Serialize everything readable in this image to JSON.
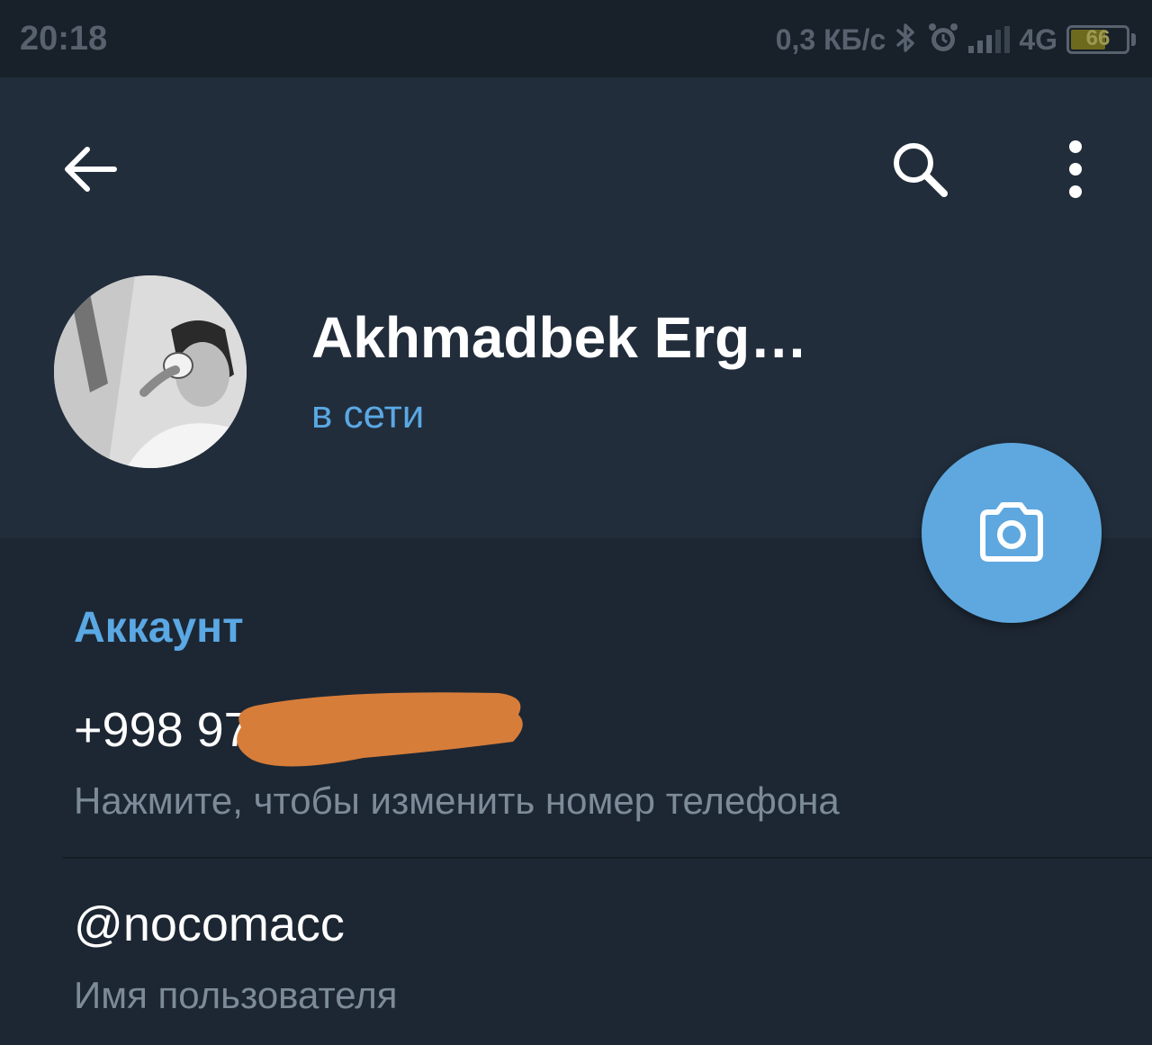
{
  "status_bar": {
    "time": "20:18",
    "network_speed": "0,3 КБ/с",
    "network_type": "4G",
    "battery": "66",
    "battery_level": 0.66,
    "icons": [
      "bluetooth-icon",
      "alarm-icon",
      "signal-icon",
      "battery-icon"
    ]
  },
  "header": {
    "icons": [
      "back-arrow-icon",
      "search-icon",
      "more-vertical-icon"
    ]
  },
  "profile": {
    "name": "Akhmadbek Erg…",
    "status": "в сети",
    "status_color": "#5aa8e4",
    "fab_icon": "camera-icon",
    "fab_color": "#5ea8df"
  },
  "account": {
    "section_title": "Аккаунт",
    "phone": {
      "value": "+998 97",
      "hint": "Нажмите, чтобы изменить номер телефона",
      "redaction_color": "#d77d3a"
    },
    "username": {
      "value": "@nocomacc",
      "hint": "Имя пользователя"
    }
  },
  "colors": {
    "background": "#1d2733",
    "header_background": "#212d3b",
    "status_bar_background": "#18202a",
    "accent": "#5aa8e4"
  }
}
